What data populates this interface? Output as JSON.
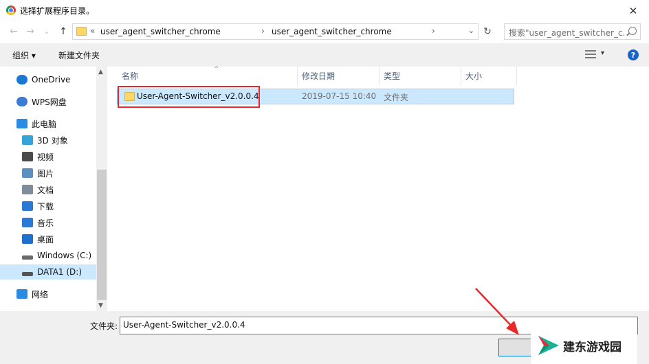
{
  "window": {
    "title": "选择扩展程序目录。",
    "close_glyph": "✕"
  },
  "nav": {
    "back_glyph": "←",
    "forward_glyph": "→",
    "recent_glyph": "⌄",
    "up_glyph": "↑",
    "breadcrumb": [
      {
        "sep": "«",
        "label": "user_agent_switcher_chrome"
      },
      {
        "sep": "›",
        "label": "user_agent_switcher_chrome"
      }
    ],
    "trailing_sep": "›",
    "dropdown_glyph": "⌄",
    "refresh_glyph": "↻",
    "search_placeholder": "搜索\"user_agent_switcher_c..."
  },
  "toolbar": {
    "organize_label": "组织 ▾",
    "new_folder_label": "新建文件夹",
    "view_dd_glyph": "▾",
    "help_label": "?"
  },
  "sidebar": {
    "items": [
      {
        "label": "OneDrive",
        "icon": "onedrive-icon",
        "indent": 1
      },
      {
        "label": "WPS网盘",
        "icon": "wps-cloud-icon",
        "indent": 1
      },
      {
        "label": "此电脑",
        "icon": "computer-icon",
        "indent": 1
      },
      {
        "label": "3D 对象",
        "icon": "3d-objects-icon",
        "indent": 2
      },
      {
        "label": "视频",
        "icon": "video-icon",
        "indent": 2
      },
      {
        "label": "图片",
        "icon": "pictures-icon",
        "indent": 2
      },
      {
        "label": "文档",
        "icon": "documents-icon",
        "indent": 2
      },
      {
        "label": "下载",
        "icon": "download-icon",
        "indent": 2
      },
      {
        "label": "音乐",
        "icon": "music-icon",
        "indent": 2
      },
      {
        "label": "桌面",
        "icon": "desktop-icon",
        "indent": 2
      },
      {
        "label": "Windows (C:)",
        "icon": "drive-c-icon",
        "indent": 2
      },
      {
        "label": "DATA1 (D:)",
        "icon": "drive-d-icon",
        "indent": 2,
        "selected": true
      },
      {
        "label": "网络",
        "icon": "network-icon",
        "indent": 1
      }
    ],
    "scroll_up_glyph": "▲",
    "scroll_down_glyph": "▼"
  },
  "columns": [
    {
      "label": "名称"
    },
    {
      "label": "修改日期"
    },
    {
      "label": "类型"
    },
    {
      "label": "大小"
    }
  ],
  "sort_caret": "^",
  "rows": [
    {
      "name": "User-Agent-Switcher_v2.0.0.4",
      "modified": "2019-07-15 10:40",
      "type": "文件夹",
      "size": ""
    }
  ],
  "footer": {
    "folder_label": "文件夹:",
    "folder_value": "User-Agent-Switcher_v2.0.0.4"
  },
  "watermark": {
    "text": "建东游戏园"
  },
  "colors": {
    "selection": "#cce8ff",
    "annotation_red": "#e8282b",
    "accent_blue": "#1a64c6"
  }
}
